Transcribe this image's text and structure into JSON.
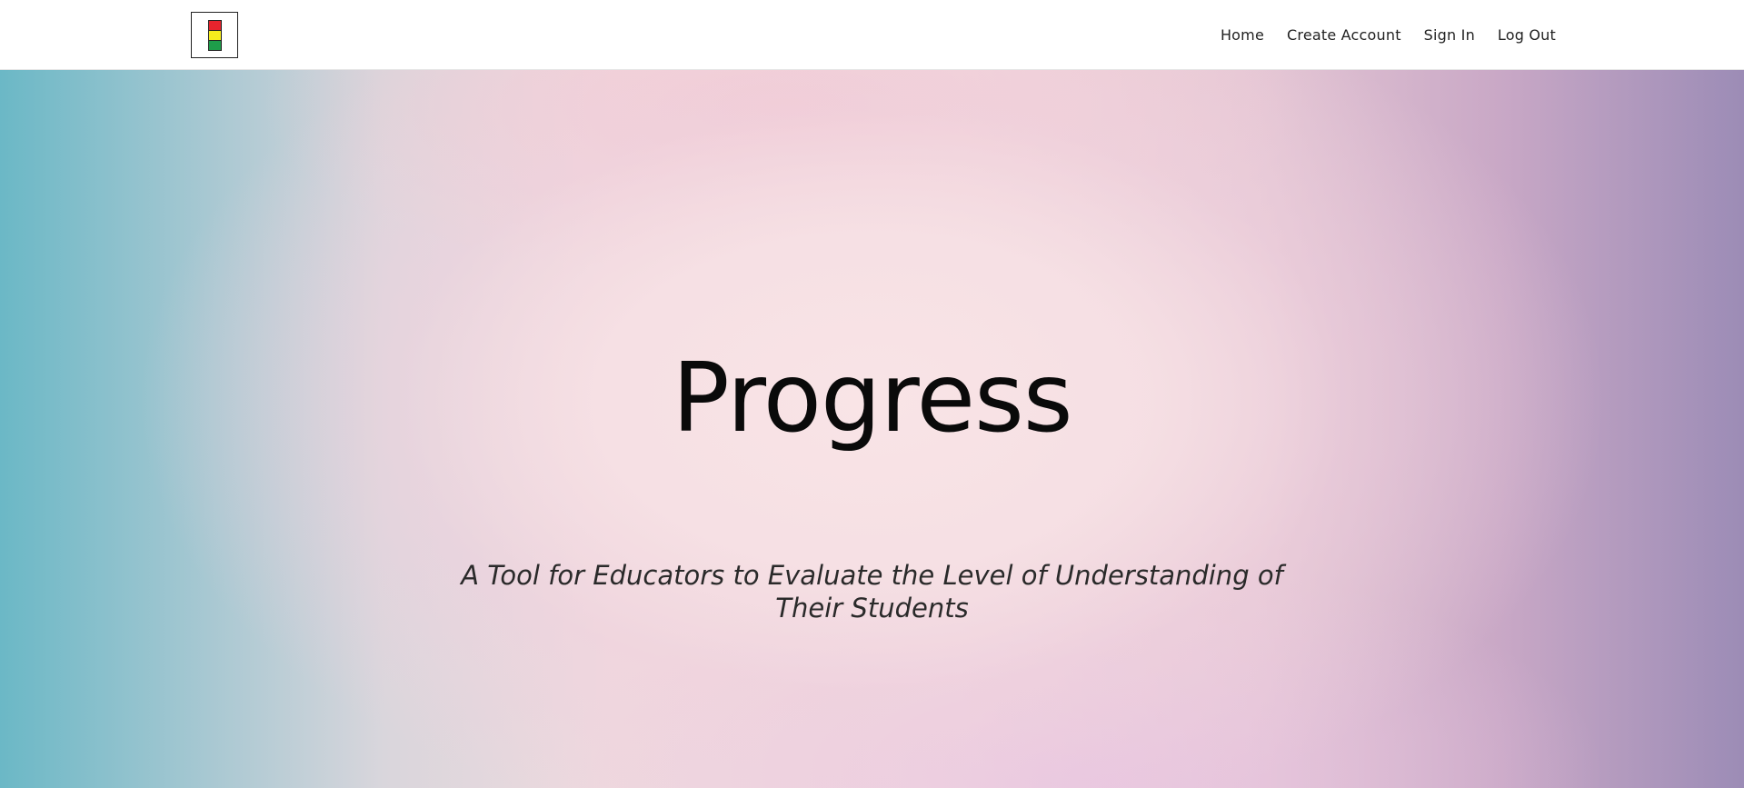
{
  "nav": {
    "logo_icon": "traffic-light-icon",
    "links": [
      {
        "label": "Home"
      },
      {
        "label": "Create Account"
      },
      {
        "label": "Sign In"
      },
      {
        "label": "Log Out"
      }
    ]
  },
  "hero": {
    "title": "Progress",
    "subtitle": "A Tool for Educators to Evaluate the Level of Understanding of Their Students"
  },
  "colors": {
    "logo_red": "#e8242d",
    "logo_yellow": "#f6ed1d",
    "logo_green": "#1e9d4a"
  }
}
